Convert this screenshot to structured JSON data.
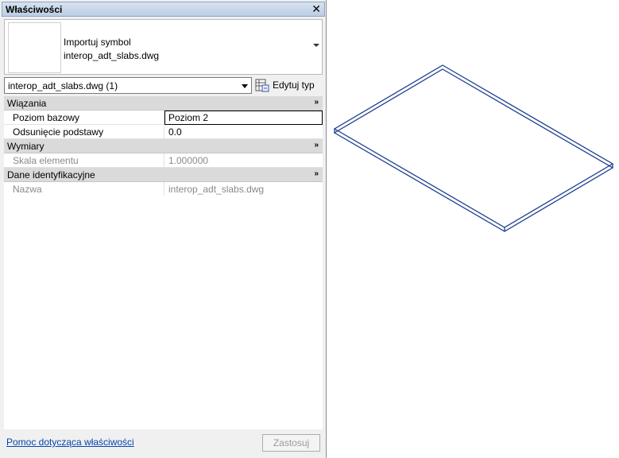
{
  "panel": {
    "title": "Właściwości",
    "type_selector": {
      "line1": "Importuj symbol",
      "line2": "interop_adt_slabs.dwg"
    },
    "instance_selector": {
      "value": "interop_adt_slabs.dwg (1)"
    },
    "edit_type_label": "Edytuj typ",
    "sections": [
      {
        "title": "Wiązania",
        "rows": [
          {
            "name": "Poziom bazowy",
            "value": "Poziom 2"
          },
          {
            "name": "Odsunięcie podstawy",
            "value": "0.0"
          }
        ]
      },
      {
        "title": "Wymiary",
        "rows": [
          {
            "name": "Skala elementu",
            "value": "1.000000"
          }
        ]
      },
      {
        "title": "Dane identyfikacyjne",
        "rows": [
          {
            "name": "Nazwa",
            "value": "interop_adt_slabs.dwg"
          }
        ]
      }
    ],
    "collapse_glyph": "»",
    "help_link": "Pomoc dotycząca właściwości",
    "apply_label": "Zastosuj"
  },
  "colors": {
    "slab_outline": "#1f3f8f",
    "link": "#0645ad"
  }
}
